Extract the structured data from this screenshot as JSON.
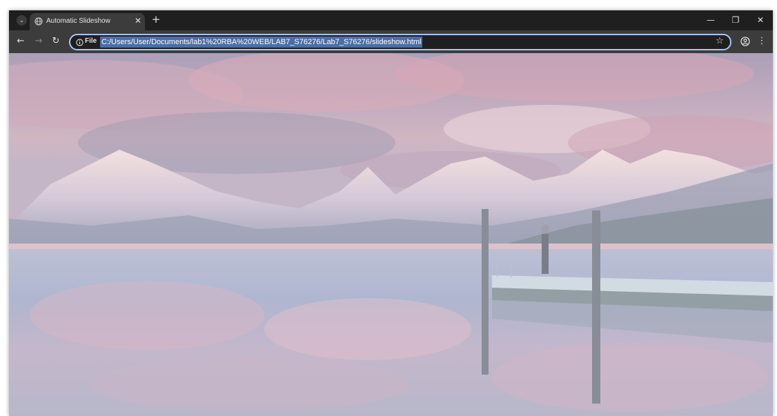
{
  "browser": {
    "tab": {
      "title": "Automatic Slideshow",
      "close_glyph": "✕",
      "favicon": "globe-icon"
    },
    "tab_menu_glyph": "⌄",
    "new_tab_glyph": "+",
    "window_controls": {
      "minimize": "—",
      "restore": "❐",
      "close": "✕"
    },
    "toolbar": {
      "back_glyph": "←",
      "forward_glyph": "→",
      "reload_glyph": "↻",
      "scheme_label": "File",
      "url": "C:/Users/User/Documents/lab1%20RBA%20WEB/LAB7_S76276/Lab7_S76276/slideshow.html",
      "bookmark_glyph": "☆",
      "menu_glyph": "⋮"
    }
  },
  "page": {
    "slide": {
      "description_icon": "landscape-photo",
      "faded": true
    }
  },
  "colors": {
    "chrome_dark": "#1f1f1f",
    "toolbar": "#3c3c3c",
    "omnibox_focus": "#a8c7fa",
    "url_selection": "#4a6fa5"
  }
}
